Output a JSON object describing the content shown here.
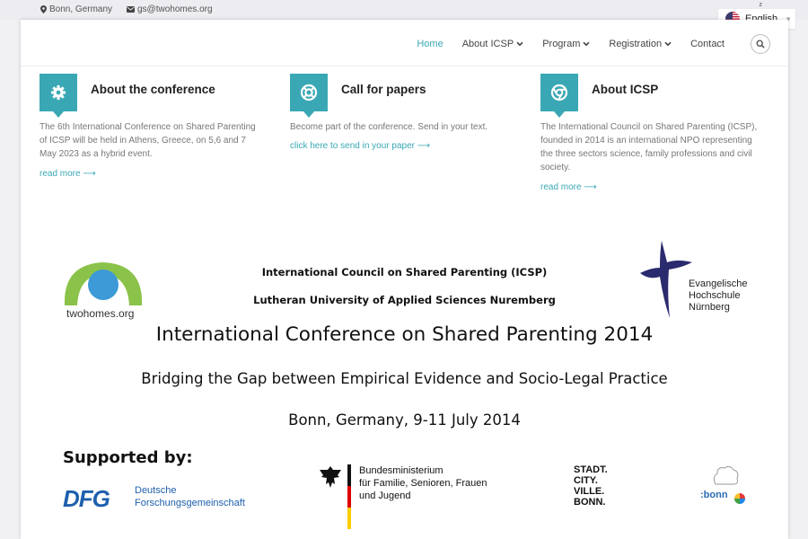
{
  "topbar": {
    "location": "Bonn, Germany",
    "email": "gs@twohomes.org"
  },
  "language": {
    "current": "English",
    "mini": "z"
  },
  "nav": {
    "home": "Home",
    "about": "About ICSP",
    "program": "Program",
    "registration": "Registration",
    "contact": "Contact"
  },
  "cards": [
    {
      "title": "About the conference",
      "text": "The 6th International Conference on Shared Parenting of ICSP will be held in Athens, Greece, on 5,6 and 7 May 2023 as a hybrid event.",
      "link": "read more"
    },
    {
      "title": "Call for papers",
      "text": "Become part of the conference. Send in your text.",
      "link": "click here to send in your paper"
    },
    {
      "title": "About ICSP",
      "text": "The International Council on Shared Parenting (ICSP), founded in 2014 is an international NPO representing the three sectors science, family professions and civil society.",
      "link": "read more"
    }
  ],
  "banner": {
    "twohomes_label": "twohomes.org",
    "org_line1": "International Council on Shared Parenting (ICSP)",
    "org_line2": "Lutheran University of Applied Sciences Nuremberg",
    "evh_label": "Evangelische\nHochschule\nNürnberg",
    "title": "International Conference on Shared Parenting 2014",
    "subtitle": "Bridging the Gap between Empirical Evidence and Socio-Legal Practice",
    "place_date": "Bonn, Germany, 9-11 July 2014",
    "supported_by": "Supported by:",
    "dfg_abbr": "DFG",
    "dfg_name": "Deutsche\nForschungsgemeinschaft",
    "bmfsfj": "Bundesministerium\nfür Familie, Senioren, Frauen\nund Jugend",
    "stadt": "STADT.\nCITY.\nVILLE.\nBONN.",
    "bonn_logo": ":bonn"
  },
  "colors": {
    "accent": "#3aa8b4",
    "dfg": "#1d5fad",
    "evh": "#2a2a6e"
  }
}
